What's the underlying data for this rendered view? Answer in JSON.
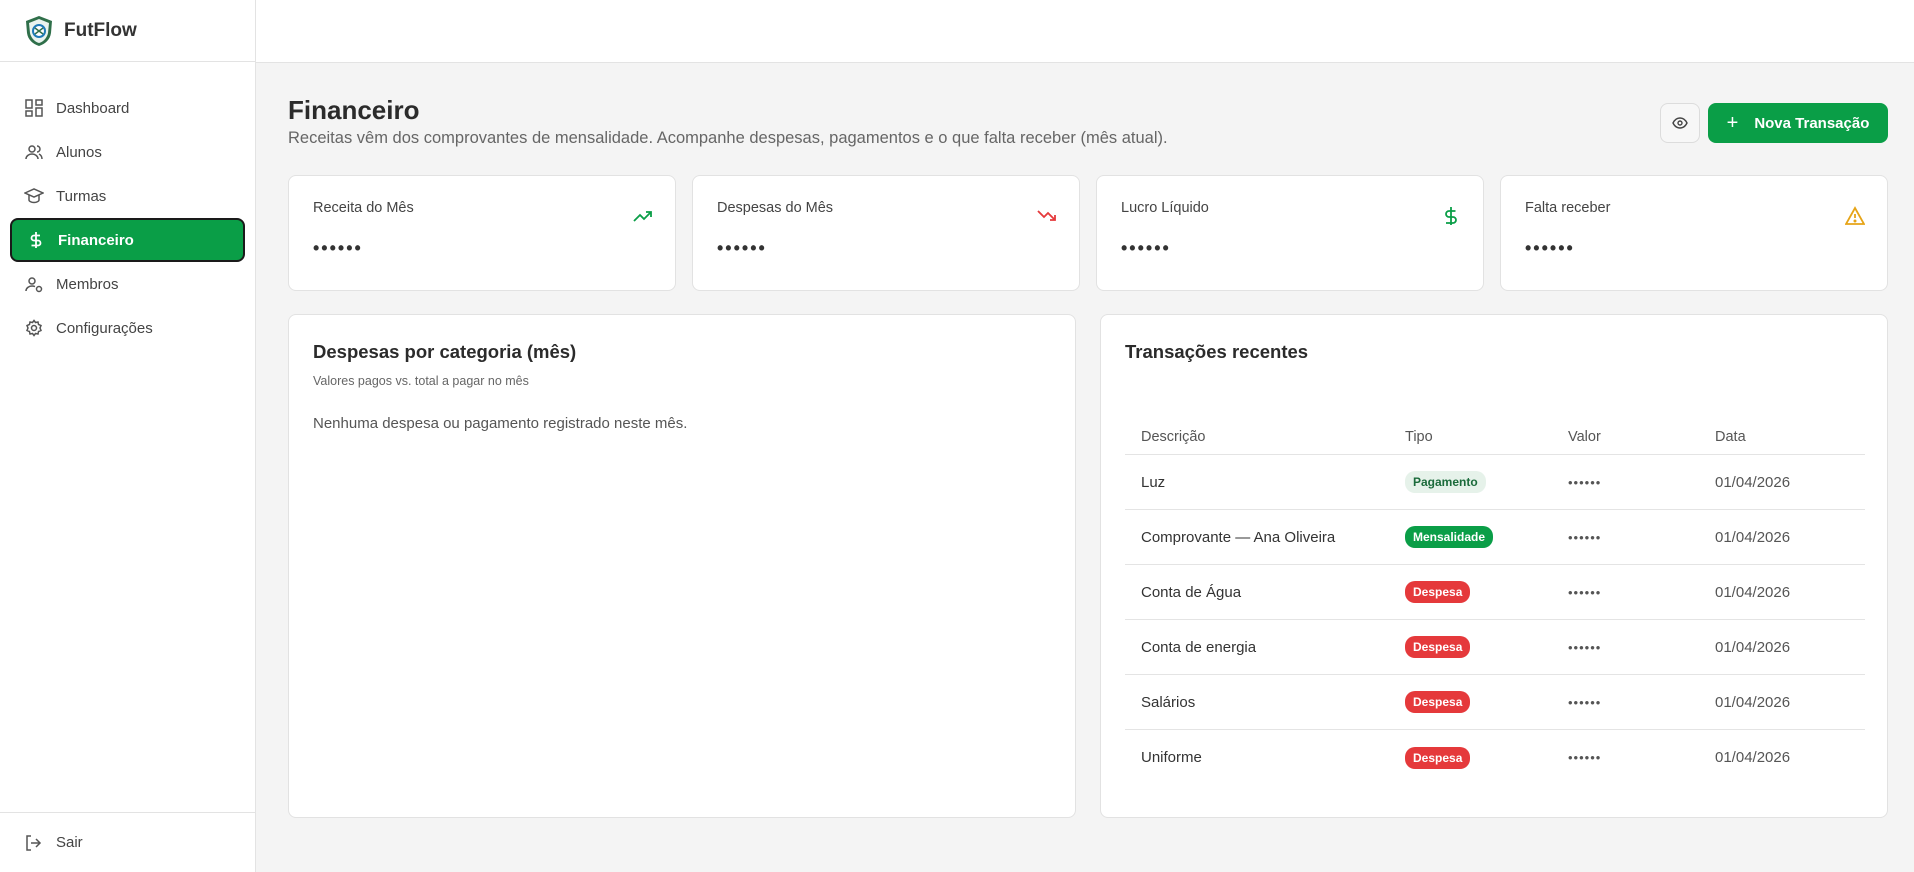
{
  "app": {
    "name": "FutFlow"
  },
  "sidebar": {
    "items": [
      {
        "label": "Dashboard",
        "icon": "dashboard-icon"
      },
      {
        "label": "Alunos",
        "icon": "users-icon"
      },
      {
        "label": "Turmas",
        "icon": "graduation-cap-icon"
      },
      {
        "label": "Financeiro",
        "icon": "dollar-icon",
        "active": true
      },
      {
        "label": "Membros",
        "icon": "user-cog-icon"
      },
      {
        "label": "Configurações",
        "icon": "gear-icon"
      }
    ],
    "footer_label": "Sair"
  },
  "header": {
    "title": "Financeiro",
    "subtitle": "Receitas vêm dos comprovantes de mensalidade. Acompanhe despesas, pagamentos e o que falta receber (mês atual).",
    "new_button_label": "Nova Transação"
  },
  "cards": [
    {
      "label": "Receita do Mês",
      "value": "••••••",
      "icon": "trending-up-icon",
      "color": "#0a9e47"
    },
    {
      "label": "Despesas do Mês",
      "value": "••••••",
      "icon": "trending-down-icon",
      "color": "#e5393b"
    },
    {
      "label": "Lucro Líquido",
      "value": "••••••",
      "icon": "dollar-icon",
      "color": "#0a9e47"
    },
    {
      "label": "Falta receber",
      "value": "••••••",
      "icon": "warning-icon",
      "color": "#e6a417"
    }
  ],
  "expenses_panel": {
    "title": "Despesas por categoria (mês)",
    "subtitle": "Valores pagos vs. total a pagar no mês",
    "empty_message": "Nenhuma despesa ou pagamento registrado neste mês."
  },
  "transactions_panel": {
    "title": "Transações recentes",
    "columns": [
      "Descrição",
      "Tipo",
      "Valor",
      "Data"
    ],
    "rows": [
      {
        "descricao": "Luz",
        "tipo": "Pagamento",
        "valor": "••••••",
        "data": "01/04/2026"
      },
      {
        "descricao": "Comprovante — Ana Oliveira",
        "tipo": "Mensalidade",
        "valor": "••••••",
        "data": "01/04/2026"
      },
      {
        "descricao": "Conta de Água",
        "tipo": "Despesa",
        "valor": "••••••",
        "data": "01/04/2026"
      },
      {
        "descricao": "Conta de energia",
        "tipo": "Despesa",
        "valor": "••••••",
        "data": "01/04/2026"
      },
      {
        "descricao": "Salários",
        "tipo": "Despesa",
        "valor": "••••••",
        "data": "01/04/2026"
      },
      {
        "descricao": "Uniforme",
        "tipo": "Despesa",
        "valor": "••••••",
        "data": "01/04/2026"
      }
    ]
  },
  "colors": {
    "accent": "#0a9e47",
    "danger": "#e5393b",
    "warning": "#e6a417"
  }
}
